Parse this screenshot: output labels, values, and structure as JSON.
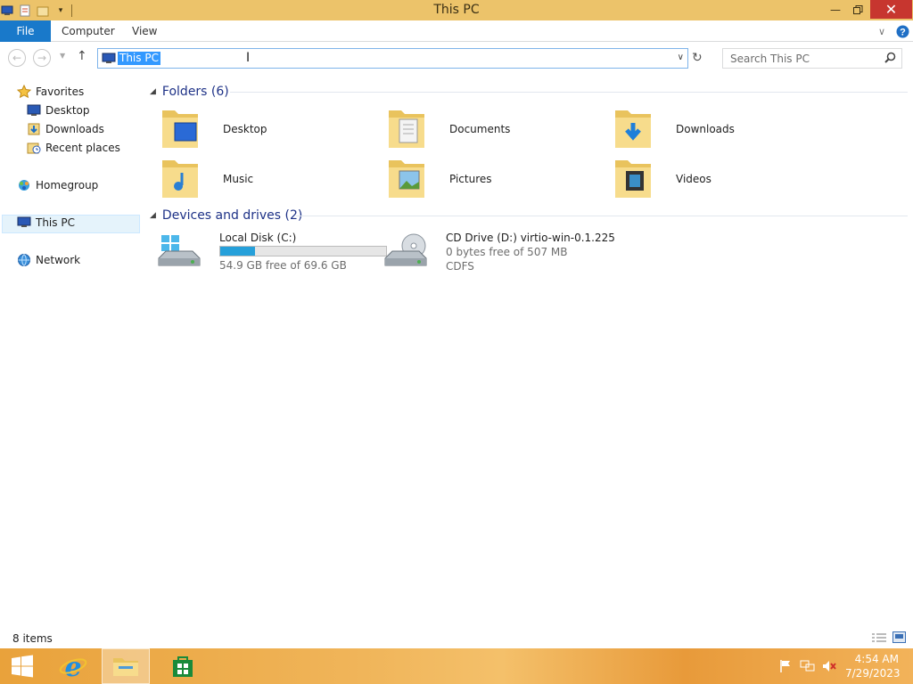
{
  "window": {
    "title": "This PC"
  },
  "ribbon": {
    "tabs": [
      "File",
      "Computer",
      "View"
    ]
  },
  "address": {
    "path": "This PC",
    "search_placeholder": "Search This PC"
  },
  "nav": {
    "favorites": "Favorites",
    "favorite_items": [
      "Desktop",
      "Downloads",
      "Recent places"
    ],
    "homegroup": "Homegroup",
    "this_pc": "This PC",
    "network": "Network"
  },
  "folders": {
    "header": "Folders (6)",
    "items": [
      "Desktop",
      "Documents",
      "Downloads",
      "Music",
      "Pictures",
      "Videos"
    ]
  },
  "drives": {
    "header": "Devices and drives (2)",
    "items": [
      {
        "name": "Local Disk (C:)",
        "free": "54.9 GB free of 69.6 GB",
        "used_fraction": 0.21
      },
      {
        "name": "CD Drive (D:) virtio-win-0.1.225",
        "free": "0 bytes free of 507 MB",
        "fs": "CDFS"
      }
    ]
  },
  "status": {
    "items": "8 items"
  },
  "taskbar": {
    "time": "4:54 AM",
    "date": "7/29/2023"
  },
  "colors": {
    "titlebar": "#ecc36a",
    "accent": "#1979ca",
    "selection": "#3399ff",
    "close": "#c7362f"
  }
}
